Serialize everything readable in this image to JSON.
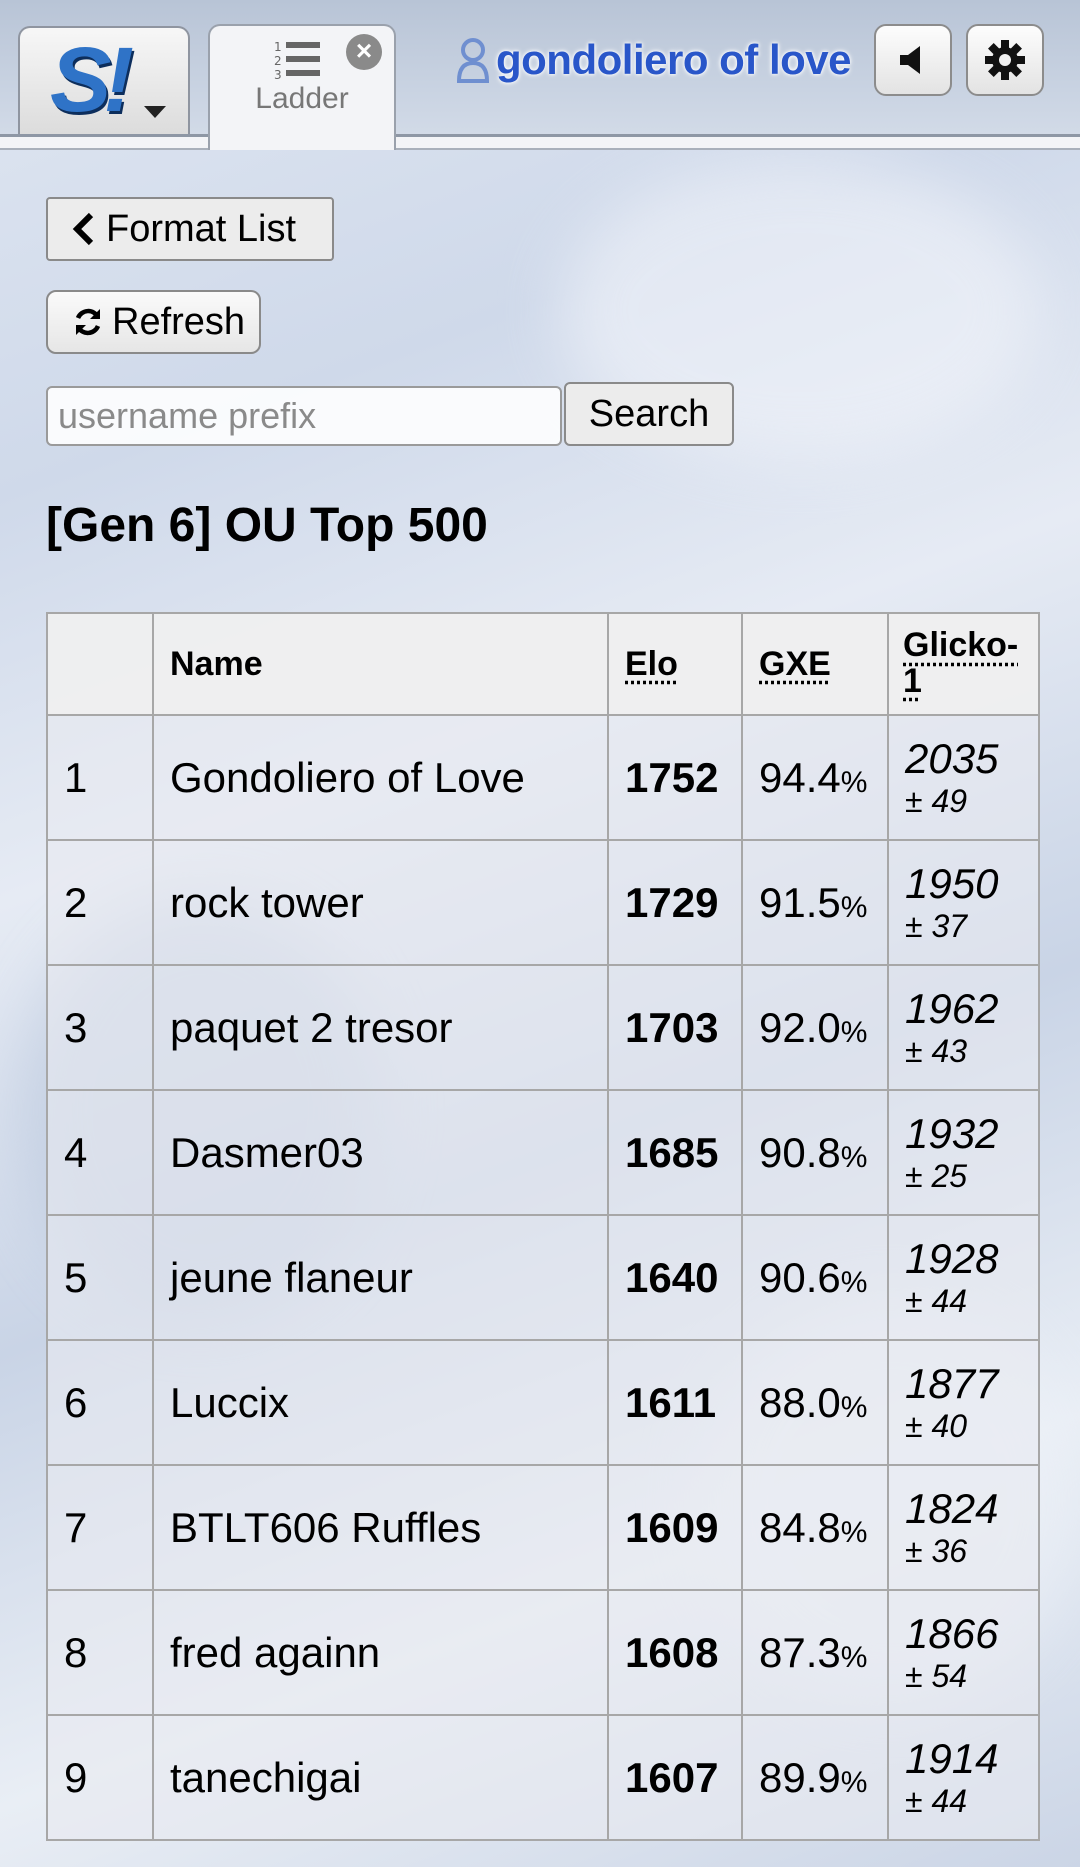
{
  "header": {
    "logo_text": "S!",
    "tab_label": "Ladder",
    "username": "gondoliero of love",
    "sound_icon": "speaker-icon",
    "settings_icon": "gear-icon"
  },
  "controls": {
    "format_list_label": "Format List",
    "refresh_label": "Refresh",
    "search_placeholder": "username prefix",
    "search_value": "",
    "search_label": "Search"
  },
  "title": "[Gen 6] OU Top 500",
  "table": {
    "headers": {
      "rank": "",
      "name": "Name",
      "elo": "Elo",
      "gxe": "GXE",
      "glicko": "Glicko-1"
    },
    "rows": [
      {
        "rank": "1",
        "name": "Gondoliero of Love",
        "elo": "1752",
        "gxe": "94.4",
        "glicko": "2035",
        "dev": "± 49"
      },
      {
        "rank": "2",
        "name": "rock tower",
        "elo": "1729",
        "gxe": "91.5",
        "glicko": "1950",
        "dev": "± 37"
      },
      {
        "rank": "3",
        "name": "paquet 2 tresor",
        "elo": "1703",
        "gxe": "92.0",
        "glicko": "1962",
        "dev": "± 43"
      },
      {
        "rank": "4",
        "name": "Dasmer03",
        "elo": "1685",
        "gxe": "90.8",
        "glicko": "1932",
        "dev": "± 25"
      },
      {
        "rank": "5",
        "name": "jeune flaneur",
        "elo": "1640",
        "gxe": "90.6",
        "glicko": "1928",
        "dev": "± 44"
      },
      {
        "rank": "6",
        "name": "Luccix",
        "elo": "1611",
        "gxe": "88.0",
        "glicko": "1877",
        "dev": "± 40"
      },
      {
        "rank": "7",
        "name": "BTLT606 Ruffles",
        "elo": "1609",
        "gxe": "84.8",
        "glicko": "1824",
        "dev": "± 36"
      },
      {
        "rank": "8",
        "name": "fred againn",
        "elo": "1608",
        "gxe": "87.3",
        "glicko": "1866",
        "dev": "± 54"
      },
      {
        "rank": "9",
        "name": "tanechigai",
        "elo": "1607",
        "gxe": "89.9",
        "glicko": "1914",
        "dev": "± 44"
      }
    ],
    "gxe_unit": "%"
  }
}
